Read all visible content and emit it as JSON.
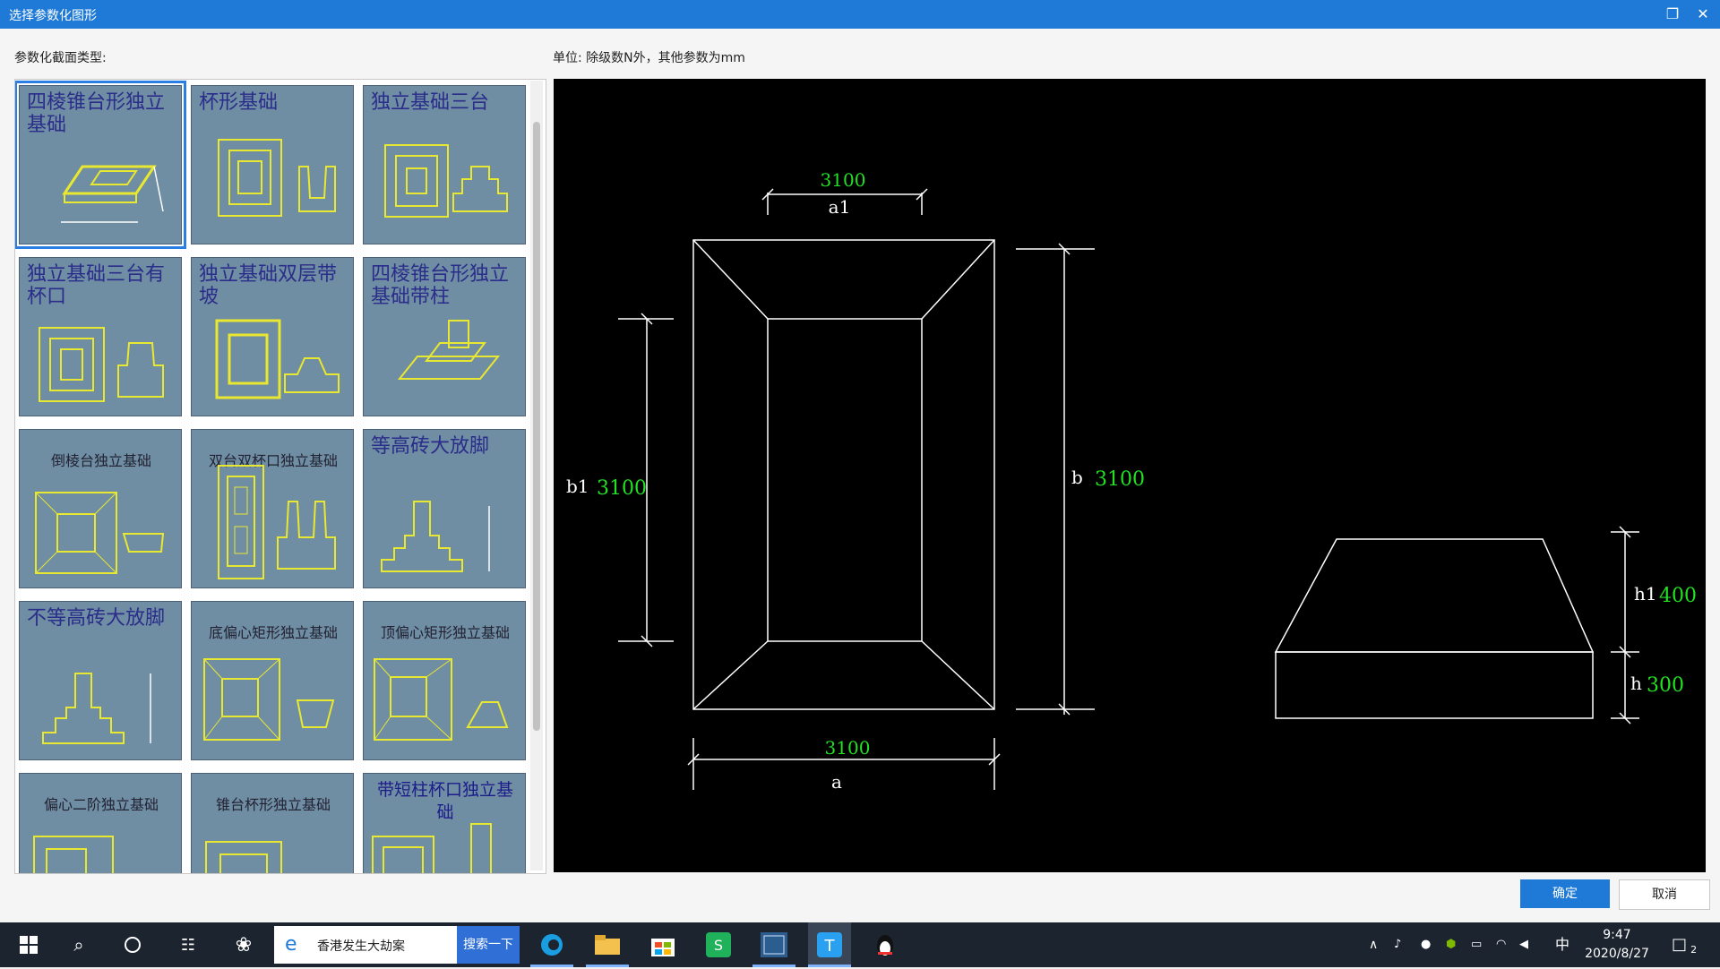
{
  "window": {
    "title": "选择参数化图形",
    "restore_icon": "restore-icon",
    "close_icon": "close-icon"
  },
  "labels": {
    "type_label": "参数化截面类型:",
    "unit_label": "单位:   除级数N外，其他参数为mm"
  },
  "gallery": {
    "tiles": [
      {
        "title": "四棱锥台形独立基础",
        "selected": true
      },
      {
        "title": "杯形基础"
      },
      {
        "title": "独立基础三台"
      },
      {
        "title": "独立基础三台有杯口"
      },
      {
        "title": "独立基础双层带坡"
      },
      {
        "title": "四棱锥台形独立基础带柱"
      },
      {
        "title": "倒棱台独立基础"
      },
      {
        "title": "双台双杯口独立基础"
      },
      {
        "title": "等高砖大放脚"
      },
      {
        "title": "不等高砖大放脚"
      },
      {
        "title": "底偏心矩形独立基础"
      },
      {
        "title": "顶偏心矩形独立基础"
      },
      {
        "title": "偏心二阶独立基础"
      },
      {
        "title": "锥台杯形独立基础"
      },
      {
        "title": "带短柱杯口独立基础"
      }
    ]
  },
  "preview": {
    "params": {
      "a1": "3100",
      "b1": "3100",
      "b": "3100",
      "a": "3100",
      "h1": "400",
      "h": "300"
    },
    "labels": {
      "a1": "a1",
      "b1": "b1",
      "b": "b",
      "a": "a",
      "h1": "h1",
      "h": "h"
    },
    "line_color": "#ffffff",
    "value_color": "#22e022"
  },
  "buttons": {
    "ok": "确定",
    "cancel": "取消"
  },
  "taskbar": {
    "search_text": "香港发生大劫案",
    "search_button": "搜索一下",
    "ime": "中",
    "time": "9:47",
    "date": "2020/8/27",
    "notification_count": "2"
  }
}
